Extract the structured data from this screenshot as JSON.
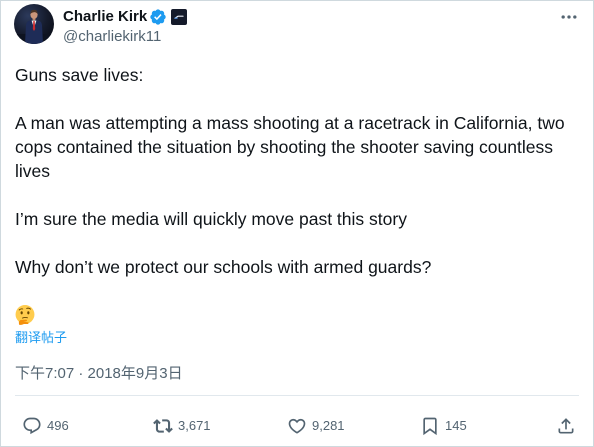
{
  "author": {
    "name": "Charlie Kirk",
    "handle": "@charliekirk11",
    "avatar_icon": "profile-avatar",
    "verified_icon": "verified-badge-icon",
    "affiliation_icon": "affiliation-badge-icon"
  },
  "more_icon": "more-options-icon",
  "tweet": {
    "paragraphs": [
      "Guns save lives:",
      "A man was attempting a mass shooting at a racetrack in California, two cops contained the situation by shooting the shooter saving countless lives",
      "I’m sure the media will quickly move past this story",
      "Why don’t we protect our schools with armed guards?"
    ],
    "emoji_icon": "thinking-face-emoji"
  },
  "translate_label": "翻译帖子",
  "timestamp": "下午7:07 · 2018年9月3日",
  "actions": {
    "reply": {
      "icon": "reply-icon",
      "count": "496"
    },
    "retweet": {
      "icon": "retweet-icon",
      "count": "3,671"
    },
    "like": {
      "icon": "like-icon",
      "count": "9,281"
    },
    "bookmark": {
      "icon": "bookmark-icon",
      "count": "145"
    },
    "share": {
      "icon": "share-icon"
    }
  },
  "colors": {
    "text": "#0f1419",
    "secondary": "#536471",
    "accent": "#1d9bf0",
    "border": "#cfd9de"
  }
}
